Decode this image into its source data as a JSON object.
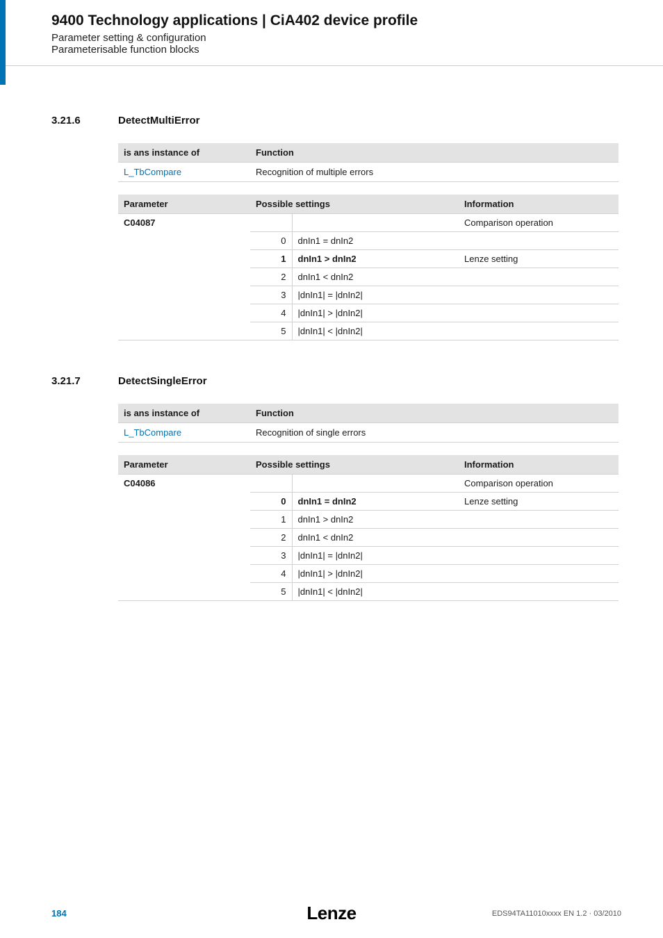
{
  "header": {
    "title": "9400 Technology applications | CiA402 device profile",
    "sub1": "Parameter setting & configuration",
    "sub2": "Parameterisable function blocks"
  },
  "sections": [
    {
      "num": "3.21.6",
      "title": "DetectMultiError",
      "instance": {
        "headers": [
          "is ans instance of",
          "Function"
        ],
        "row": {
          "link": "L_TbCompare",
          "func": "Recognition of multiple errors"
        }
      },
      "param": {
        "headers": [
          "Parameter",
          "Possible settings",
          "Information"
        ],
        "pname": "C04087",
        "info_top": "Comparison operation",
        "rows": [
          {
            "n": "0",
            "s": "dnIn1 = dnIn2",
            "info": "",
            "bold": false
          },
          {
            "n": "1",
            "s": "dnIn1 > dnIn2",
            "info": "Lenze setting",
            "bold": true
          },
          {
            "n": "2",
            "s": "dnIn1 < dnIn2",
            "info": "",
            "bold": false
          },
          {
            "n": "3",
            "s": "|dnIn1| = |dnIn2|",
            "info": "",
            "bold": false
          },
          {
            "n": "4",
            "s": "|dnIn1| > |dnIn2|",
            "info": "",
            "bold": false
          },
          {
            "n": "5",
            "s": "|dnIn1| < |dnIn2|",
            "info": "",
            "bold": false
          }
        ]
      }
    },
    {
      "num": "3.21.7",
      "title": "DetectSingleError",
      "instance": {
        "headers": [
          "is ans instance of",
          "Function"
        ],
        "row": {
          "link": "L_TbCompare",
          "func": "Recognition of single errors"
        }
      },
      "param": {
        "headers": [
          "Parameter",
          "Possible settings",
          "Information"
        ],
        "pname": "C04086",
        "info_top": "Comparison operation",
        "rows": [
          {
            "n": "0",
            "s": "dnIn1 = dnIn2",
            "info": "Lenze setting",
            "bold": true
          },
          {
            "n": "1",
            "s": "dnIn1 > dnIn2",
            "info": "",
            "bold": false
          },
          {
            "n": "2",
            "s": "dnIn1 < dnIn2",
            "info": "",
            "bold": false
          },
          {
            "n": "3",
            "s": "|dnIn1| = |dnIn2|",
            "info": "",
            "bold": false
          },
          {
            "n": "4",
            "s": "|dnIn1| > |dnIn2|",
            "info": "",
            "bold": false
          },
          {
            "n": "5",
            "s": "|dnIn1| < |dnIn2|",
            "info": "",
            "bold": false
          }
        ]
      }
    }
  ],
  "footer": {
    "page": "184",
    "brand": "Lenze",
    "docid": "EDS94TA11010xxxx EN 1.2 · 03/2010"
  }
}
